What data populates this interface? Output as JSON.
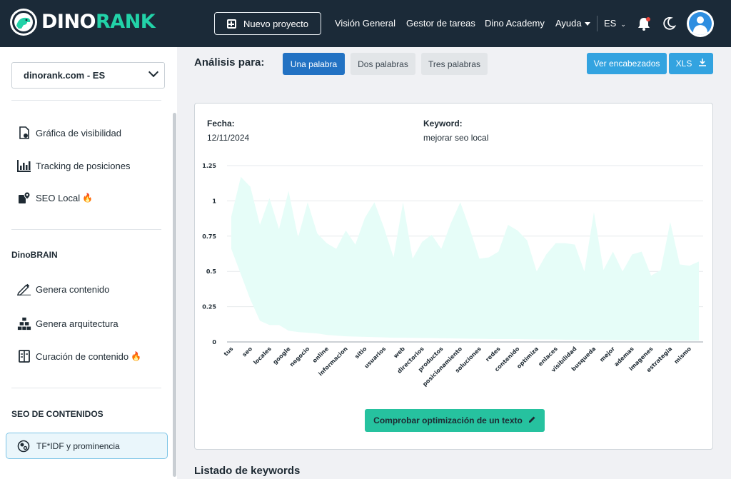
{
  "brand": {
    "word1": "DINO",
    "word2": "RANK",
    "accent": "#22d2a8",
    "navbar_bg": "#1b2a38"
  },
  "topnav": {
    "new_project": "Nuevo proyecto",
    "links": [
      "Visión General",
      "Gestor de tareas",
      "Dino Academy",
      "Ayuda"
    ],
    "language": "ES",
    "icons": [
      "bell-icon",
      "moon-icon",
      "user-avatar-icon"
    ]
  },
  "sidebar": {
    "site": "dinorank.com - ES",
    "group1": [
      {
        "label": "Gráfica de visibilidad",
        "icon": "visibility-chart-icon"
      },
      {
        "label": "Tracking de posiciones",
        "icon": "bar-chart-icon"
      },
      {
        "label": "SEO Local",
        "icon": "map-pin-icon",
        "fire": "🔥"
      }
    ],
    "dinobrain_heading": "DinoBRAIN",
    "group2": [
      {
        "label": "Genera contenido",
        "icon": "pen-icon"
      },
      {
        "label": "Genera arquitectura",
        "icon": "sitemap-icon"
      },
      {
        "label": "Curación de contenido",
        "icon": "book-icon",
        "fire": "🔥"
      }
    ],
    "seo_heading": "SEO DE CONTENIDOS",
    "active_item": {
      "label": "TF*IDF y prominencia",
      "icon": "tfidf-icon"
    }
  },
  "main": {
    "analysis_label": "Análisis para:",
    "tabs": [
      {
        "label": "Una palabra",
        "active": true
      },
      {
        "label": "Dos palabras",
        "active": false
      },
      {
        "label": "Tres palabras",
        "active": false
      }
    ],
    "actions": {
      "headers": "Ver encabezados",
      "xls": "XLS"
    },
    "fecha_label": "Fecha:",
    "fecha_value": "12/11/2024",
    "keyword_label": "Keyword:",
    "keyword_value": "mejorar seo local",
    "check_button": "Comprobar optimización de un texto",
    "list_title": "Listado de keywords"
  },
  "chart_data": {
    "type": "area",
    "fill_color": "#e6fdf8",
    "ylim": [
      0,
      1.25
    ],
    "yticks": [
      "0",
      "0.25",
      "0.5",
      "0.75",
      "1",
      "1.25"
    ],
    "ytick_values": [
      0,
      0.25,
      0.5,
      0.75,
      1,
      1.25
    ],
    "x_labels": [
      "tus",
      "seo",
      "locales",
      "google",
      "negocio",
      "online",
      "informacion",
      "sitio",
      "usuarios",
      "web",
      "directorios",
      "productos",
      "posicionamiento",
      "soluciones",
      "redes",
      "contenido",
      "optimiza",
      "enlaces",
      "visibilidad",
      "busqueda",
      "mejor",
      "ademas",
      "imagenes",
      "estrategia",
      "mismo"
    ],
    "x_count": 50,
    "series": [
      {
        "name": "upper",
        "values": [
          0.89,
          1.17,
          1.1,
          0.83,
          1.02,
          0.8,
          1.07,
          0.74,
          0.99,
          0.77,
          0.7,
          0.66,
          0.79,
          0.69,
          0.88,
          0.99,
          0.81,
          0.6,
          0.99,
          0.59,
          0.71,
          0.76,
          0.66,
          0.84,
          0.99,
          0.8,
          0.59,
          0.6,
          0.64,
          0.83,
          0.79,
          0.72,
          0.5,
          0.62,
          0.7,
          0.7,
          0.69,
          0.5,
          0.92,
          0.51,
          0.64,
          0.5,
          0.62,
          0.64,
          0.47,
          0.51,
          0.85,
          0.55,
          0.54,
          0.57
        ]
      },
      {
        "name": "lower",
        "values": [
          0.66,
          0.48,
          0.3,
          0.15,
          0.12,
          0.12,
          0.08,
          0.07,
          0.065,
          0.06,
          0.05,
          0.045,
          0.04,
          0.038,
          0.036,
          0.034,
          0.032,
          0.03,
          0.03,
          0.029,
          0.028,
          0.027,
          0.026,
          0.025,
          0.024,
          0.023,
          0.022,
          0.021,
          0.02,
          0.02,
          0.02,
          0.019,
          0.018,
          0.018,
          0.017,
          0.016,
          0.016,
          0.015,
          0.015,
          0.014,
          0.014,
          0.013,
          0.013,
          0.012,
          0.012,
          0.012,
          0.011,
          0.011,
          0.01,
          0.01
        ]
      }
    ]
  }
}
